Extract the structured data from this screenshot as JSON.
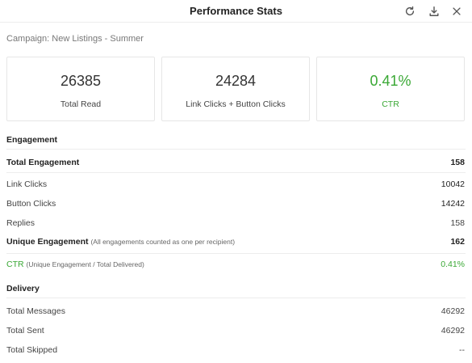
{
  "header": {
    "title": "Performance Stats",
    "icons": [
      "refresh-icon",
      "download-icon",
      "close-icon"
    ]
  },
  "campaign": {
    "label": "Campaign:",
    "name": "New Listings - Summer"
  },
  "cards": [
    {
      "value": "26385",
      "label": "Total Read"
    },
    {
      "value": "24284",
      "label": "Link Clicks + Button Clicks"
    },
    {
      "value": "0.41%",
      "label": "CTR"
    }
  ],
  "engagement": {
    "title": "Engagement",
    "total": {
      "label": "Total Engagement",
      "value": "158"
    },
    "link_clicks": {
      "label": "Link Clicks",
      "value": "10042"
    },
    "button_clicks": {
      "label": "Button Clicks",
      "value": "14242"
    },
    "replies": {
      "label": "Replies",
      "value": "158"
    },
    "unique": {
      "label": "Unique Engagement",
      "note": "(All engagements counted as one per recipient)",
      "value": "162"
    },
    "ctr": {
      "label": "CTR",
      "note": "(Unique Engagement / Total Delivered)",
      "value": "0.41%"
    }
  },
  "delivery": {
    "title": "Delivery",
    "total_messages": {
      "label": "Total Messages",
      "value": "46292"
    },
    "total_sent": {
      "label": "Total Sent",
      "value": "46292"
    },
    "total_skipped": {
      "label": "Total Skipped",
      "value": "--"
    }
  },
  "colors": {
    "accent_green": "#3aa835",
    "border": "#e6e6e6"
  }
}
